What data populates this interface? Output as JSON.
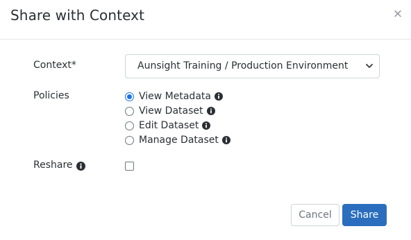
{
  "modal": {
    "title": "Share with Context",
    "close_glyph": "×"
  },
  "form": {
    "context": {
      "label": "Context*",
      "selected": "Aunsight Training / Production Environment",
      "chevron_icon": "chevron-down-icon"
    },
    "policies": {
      "label": "Policies",
      "options": [
        {
          "label": "View Metadata",
          "checked": true
        },
        {
          "label": "View Dataset",
          "checked": false
        },
        {
          "label": "Edit Dataset",
          "checked": false
        },
        {
          "label": "Manage Dataset",
          "checked": false
        }
      ],
      "info_icon": "info-circle-icon"
    },
    "reshare": {
      "label": "Reshare",
      "checked": false,
      "info_icon": "info-circle-icon"
    }
  },
  "footer": {
    "cancel_label": "Cancel",
    "share_label": "Share"
  },
  "colors": {
    "primary": "#2a6ebd",
    "radio_checked": "#1a73e8",
    "border": "#cfd4d9",
    "text": "#2b2f33"
  }
}
